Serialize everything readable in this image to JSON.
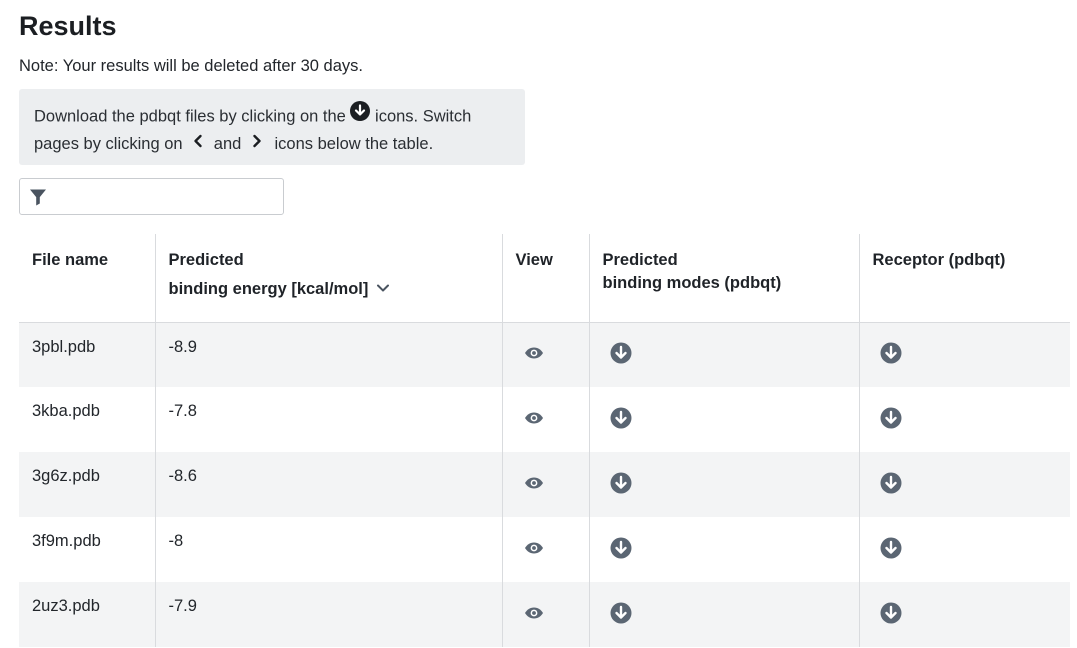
{
  "page": {
    "title": "Results",
    "note": "Note: Your results will be deleted after 30 days."
  },
  "info": {
    "part1": "Download the pdbqt files by clicking on the ",
    "part2": " icons. Switch",
    "part3": "pages by clicking on ",
    "part4": " and ",
    "part5": " icons below the table.",
    "icons": [
      "download-circle-icon",
      "chevron-left-icon",
      "chevron-right-icon"
    ]
  },
  "filter": {
    "value": "",
    "placeholder": "",
    "icon": "filter-funnel-icon"
  },
  "table": {
    "headers": {
      "file": "File name",
      "energy_line1": "Predicted",
      "energy_line2": "binding energy [kcal/mol]",
      "view": "View",
      "modes_line1": "Predicted",
      "modes_line2": "binding modes (pdbqt)",
      "receptor": "Receptor (pdbqt)"
    },
    "sort_icon": "chevron-down-icon",
    "rows": [
      {
        "file": "3pbl.pdb",
        "energy": "-8.9"
      },
      {
        "file": "3kba.pdb",
        "energy": "-7.8"
      },
      {
        "file": "3g6z.pdb",
        "energy": "-8.6"
      },
      {
        "file": "3f9m.pdb",
        "energy": "-8"
      },
      {
        "file": "2uz3.pdb",
        "energy": "-7.9"
      }
    ]
  },
  "colors": {
    "icon": "#5b6673",
    "shaded_row": "#f3f4f5",
    "info_bg": "#eceef0",
    "border": "#d9dbde"
  }
}
